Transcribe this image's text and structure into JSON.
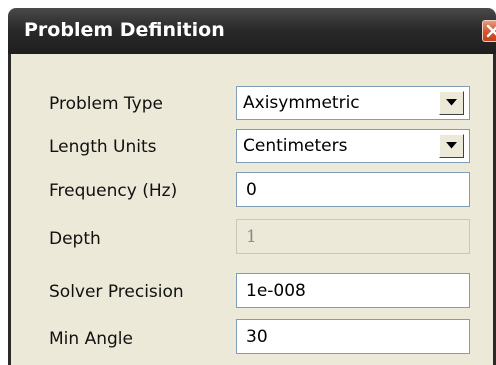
{
  "dialog": {
    "title": "Problem Definition",
    "close_icon": "close-icon"
  },
  "fields": {
    "problem_type": {
      "label": "Problem Type",
      "value": "Axisymmetric"
    },
    "length_units": {
      "label": "Length Units",
      "value": "Centimeters"
    },
    "frequency": {
      "label": "Frequency (Hz)",
      "value": "0"
    },
    "depth": {
      "label": "Depth",
      "value": "1",
      "disabled": true
    },
    "solver_precision": {
      "label": "Solver Precision",
      "value": "1e-008"
    },
    "min_angle": {
      "label": "Min Angle",
      "value": "30"
    }
  },
  "colors": {
    "titlebar": "#2a2a2a",
    "client_bg": "#ece9d8",
    "close_button": "#d2562e",
    "input_border": "#7f9db9"
  }
}
